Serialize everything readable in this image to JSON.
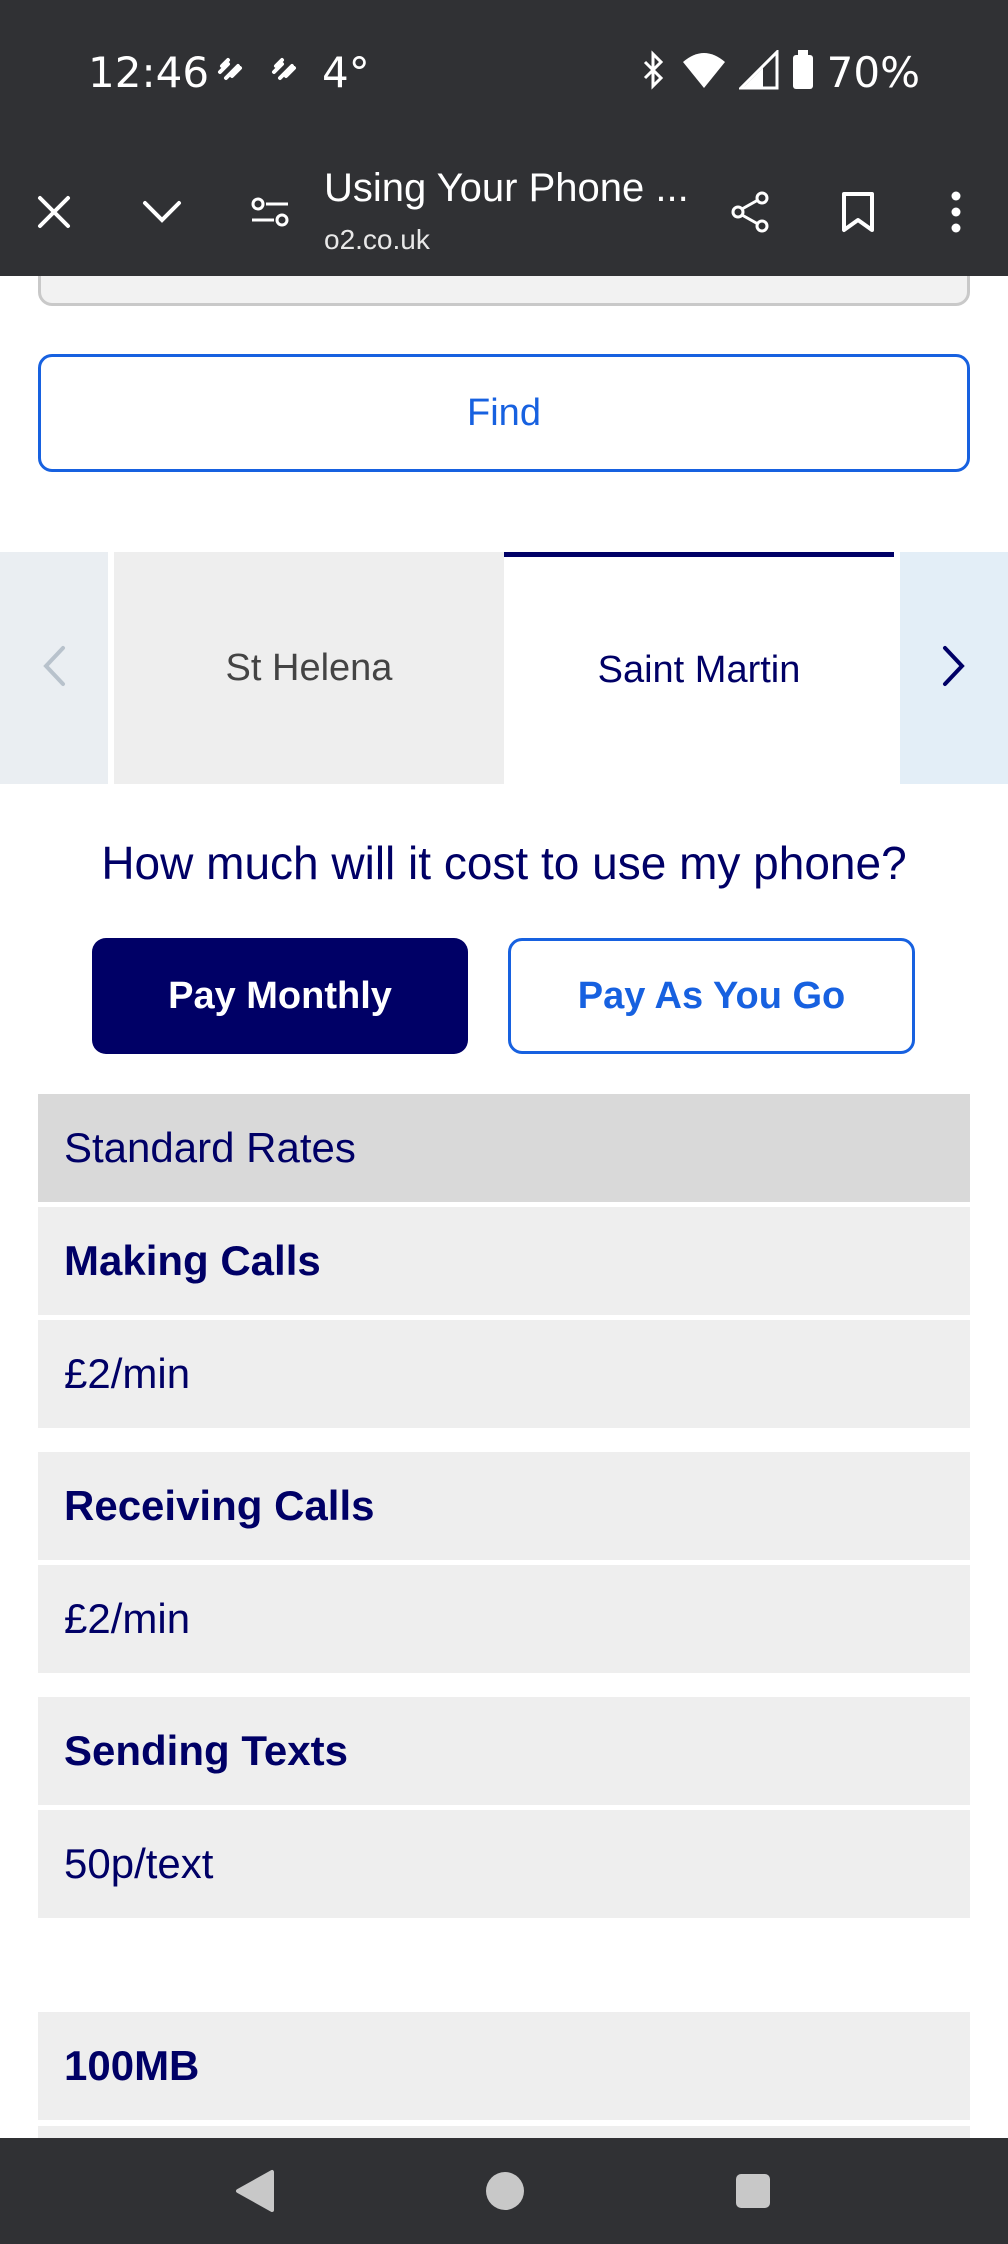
{
  "status_bar": {
    "time": "12:46",
    "temperature": "4°",
    "battery": "70%"
  },
  "browser": {
    "page_title": "Using Your Phone ...",
    "url": "o2.co.uk"
  },
  "search": {
    "find_label": "Find"
  },
  "destination_tabs": {
    "items": [
      {
        "label": "St Helena",
        "active": false
      },
      {
        "label": "Saint Martin",
        "active": true
      }
    ]
  },
  "cost_section": {
    "question": "How much will it cost to use my phone?",
    "plans": [
      {
        "label": "Pay Monthly",
        "selected": true
      },
      {
        "label": "Pay As You Go",
        "selected": false
      }
    ]
  },
  "rates": {
    "heading": "Standard Rates",
    "making_calls_label": "Making Calls",
    "making_calls_value": "£2/min",
    "receiving_calls_label": "Receiving Calls",
    "receiving_calls_value": "£2/min",
    "sending_texts_label": "Sending Texts",
    "sending_texts_value": "50p/text",
    "data_label": "100MB"
  },
  "colors": {
    "brand_navy": "#000066",
    "link_blue": "#1761e0",
    "system_bar": "#303134"
  }
}
